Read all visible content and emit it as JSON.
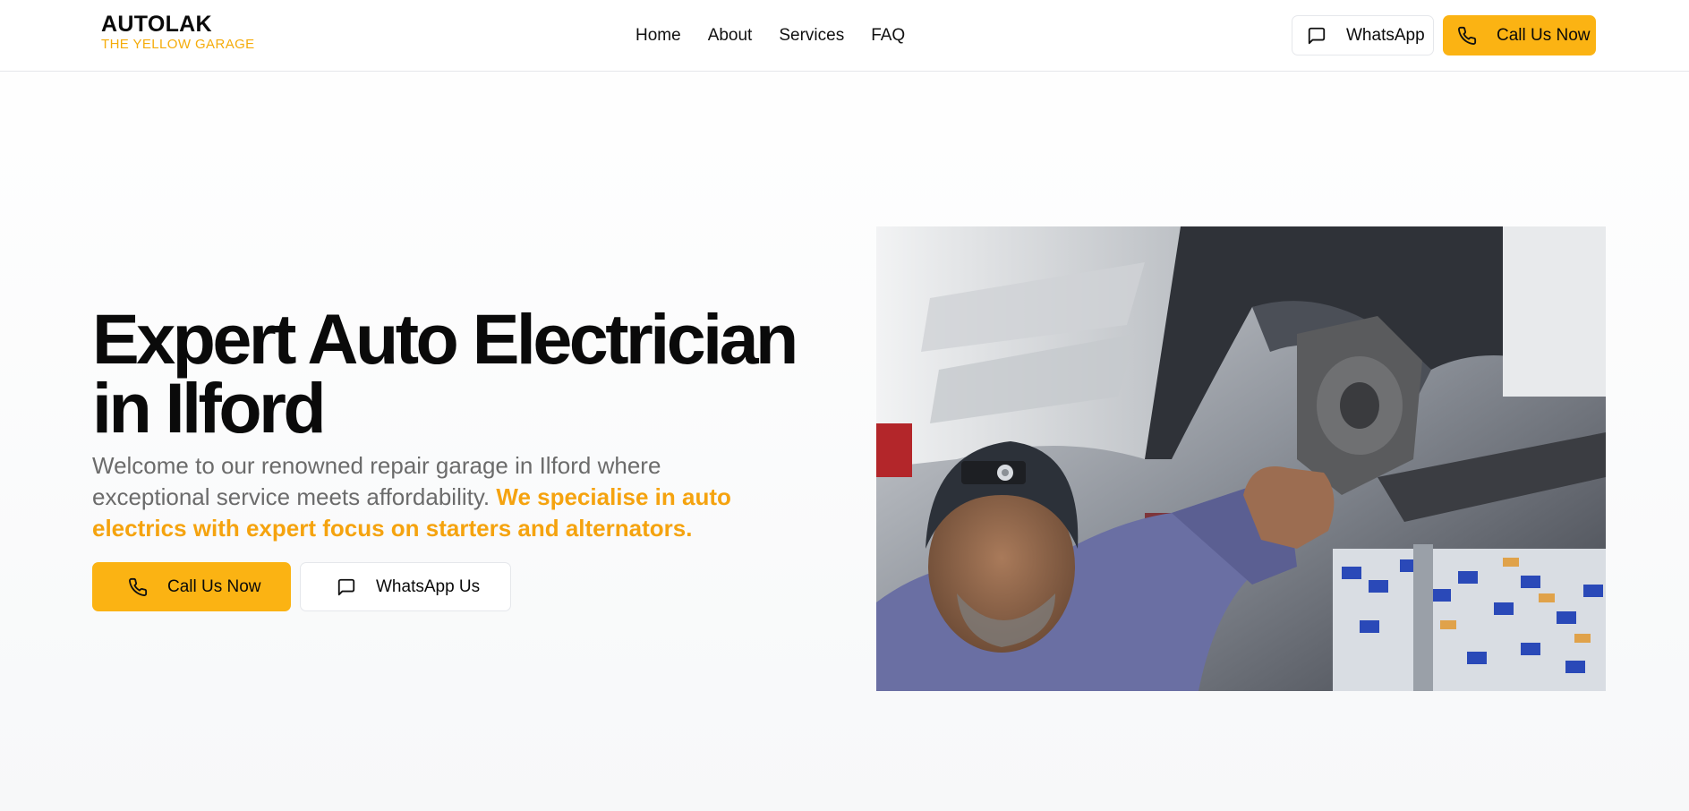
{
  "brand": {
    "name": "AUTOLAK",
    "tagline": "THE YELLOW GARAGE",
    "accent_color": "#fbb313"
  },
  "nav": {
    "items": [
      "Home",
      "About",
      "Services",
      "FAQ"
    ]
  },
  "header_actions": {
    "whatsapp": {
      "label": "WhatsApp",
      "icon": "message-square-icon"
    },
    "call": {
      "label": "Call Us Now",
      "icon": "phone-icon"
    }
  },
  "hero": {
    "title": "Expert Auto Electrician in Ilford",
    "description": "Welcome to our renowned repair garage in Ilford where exceptional service meets affordability. ",
    "highlight": "We specialise in auto electrics with expert focus on starters and alternators.",
    "highlight_color": "#f5a30f",
    "primary_button": {
      "label": "Call Us Now",
      "icon": "phone-icon"
    },
    "secondary_button": {
      "label": "WhatsApp Us",
      "icon": "message-square-icon"
    },
    "image": {
      "alt_description": "mechanic-under-car-photo"
    }
  }
}
